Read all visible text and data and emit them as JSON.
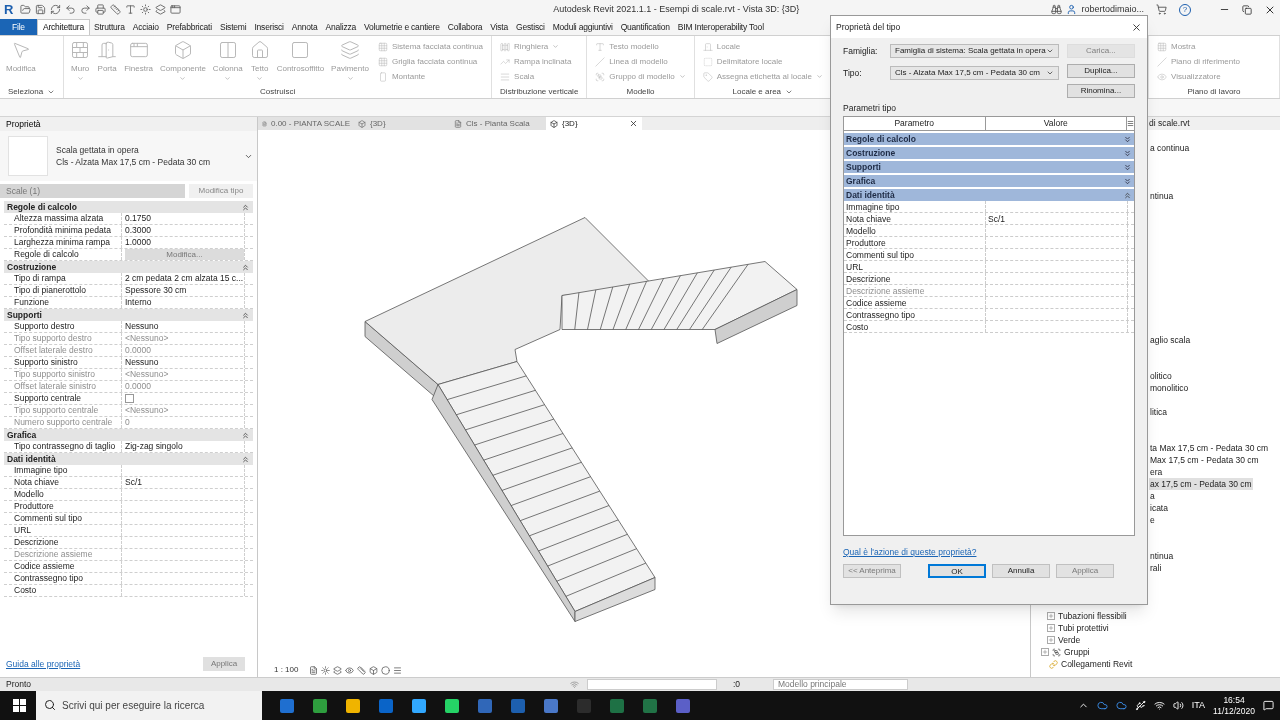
{
  "title_bar": {
    "logo": "R",
    "title": "Autodesk Revit 2021.1.1 - Esempi di scale.rvt - Vista 3D: {3D}",
    "user": "robertodimaio...",
    "help": "?"
  },
  "ribbon_tabs": [
    {
      "label": "File",
      "kind": "file",
      "selected": false
    },
    {
      "label": "Architettura",
      "kind": "tab",
      "selected": true
    },
    {
      "label": "Struttura",
      "kind": "tab",
      "selected": false
    },
    {
      "label": "Acciaio",
      "kind": "tab",
      "selected": false
    },
    {
      "label": "Prefabbricati",
      "kind": "tab",
      "selected": false
    },
    {
      "label": "Sistemi",
      "kind": "tab",
      "selected": false
    },
    {
      "label": "Inserisci",
      "kind": "tab",
      "selected": false
    },
    {
      "label": "Annota",
      "kind": "tab",
      "selected": false
    },
    {
      "label": "Analizza",
      "kind": "tab",
      "selected": false
    },
    {
      "label": "Volumetrie e cantiere",
      "kind": "tab",
      "selected": false
    },
    {
      "label": "Collabora",
      "kind": "tab",
      "selected": false
    },
    {
      "label": "Vista",
      "kind": "tab",
      "selected": false
    },
    {
      "label": "Gestisci",
      "kind": "tab",
      "selected": false
    },
    {
      "label": "Moduli aggiuntivi",
      "kind": "tab",
      "selected": false
    },
    {
      "label": "Quantification",
      "kind": "tab",
      "selected": false
    },
    {
      "label": "BIM Interoperability Tool",
      "kind": "tab",
      "selected": false
    }
  ],
  "ribbon_panels": [
    {
      "label": "Seleziona",
      "menu": true,
      "large": [
        {
          "label": "Modifica",
          "menu": false
        }
      ]
    },
    {
      "label": "Costruisci",
      "menu": false,
      "large": [
        {
          "label": "Muro",
          "menu": true
        },
        {
          "label": "Porta",
          "menu": false
        },
        {
          "label": "Finestra",
          "menu": false
        },
        {
          "label": "Componente",
          "menu": true
        },
        {
          "label": "Colonna",
          "menu": true
        },
        {
          "label": "Tetto",
          "menu": true
        },
        {
          "label": "Controsoffitto",
          "menu": false
        },
        {
          "label": "Pavimento",
          "menu": true
        }
      ],
      "small": [
        {
          "label": "Sistema facciata continua",
          "menu": false
        },
        {
          "label": "Griglia facciata continua",
          "menu": false
        },
        {
          "label": "Montante",
          "menu": false
        }
      ]
    },
    {
      "label": "Distribuzione verticale",
      "menu": false,
      "small": [
        {
          "label": "Ringhiera",
          "menu": true
        },
        {
          "label": "Rampa inclinata",
          "menu": false
        },
        {
          "label": "Scala",
          "menu": false
        }
      ]
    },
    {
      "label": "Modello",
      "menu": false,
      "small": [
        {
          "label": "Testo modello",
          "menu": false
        },
        {
          "label": "Linea di modello",
          "menu": false
        },
        {
          "label": "Gruppo di modello",
          "menu": true
        }
      ]
    },
    {
      "label": "Locale e area",
      "menu": true,
      "small": [
        {
          "label": "Locale",
          "menu": false
        },
        {
          "label": "Delimitatore locale",
          "menu": false
        },
        {
          "label": "Assegna etichetta al locale",
          "menu": true
        }
      ]
    },
    {
      "label": "Piano di lavoro",
      "menu": false,
      "small": [
        {
          "label": "Mostra",
          "menu": false
        },
        {
          "label": "Piano di riferimento",
          "menu": false
        },
        {
          "label": "Visualizzatore",
          "menu": false
        }
      ]
    }
  ],
  "properties": {
    "title": "Proprietà",
    "type_family": "Scala gettata in opera",
    "type_name": "Cls - Alzata Max 17,5 cm - Pedata 30 cm",
    "filter": "Scale (1)",
    "edit_type": "Modifica tipo",
    "groups": [
      {
        "name": "Regole di calcolo",
        "expanded": true,
        "rows": [
          {
            "label": "Altezza massima alzata",
            "value": "0.1750",
            "kind": "text",
            "dim": false
          },
          {
            "label": "Profondità minima pedata",
            "value": "0.3000",
            "kind": "text",
            "dim": false
          },
          {
            "label": "Larghezza minima rampa",
            "value": "1.0000",
            "kind": "text",
            "dim": false
          },
          {
            "label": "Regole di calcolo",
            "value": "Modifica...",
            "kind": "button",
            "dim": false
          }
        ]
      },
      {
        "name": "Costruzione",
        "expanded": true,
        "rows": [
          {
            "label": "Tipo di rampa",
            "value": "2 cm pedata 2 cm alzata 15 c...",
            "kind": "text",
            "dim": false
          },
          {
            "label": "Tipo di pianerottolo",
            "value": "Spessore 30 cm",
            "kind": "text",
            "dim": false
          },
          {
            "label": "Funzione",
            "value": "Interno",
            "kind": "text",
            "dim": false
          }
        ]
      },
      {
        "name": "Supporti",
        "expanded": true,
        "rows": [
          {
            "label": "Supporto destro",
            "value": "Nessuno",
            "kind": "text",
            "dim": false
          },
          {
            "label": "Tipo supporto destro",
            "value": "<Nessuno>",
            "kind": "text",
            "dim": true
          },
          {
            "label": "Offset laterale destro",
            "value": "0.0000",
            "kind": "text",
            "dim": true
          },
          {
            "label": "Supporto sinistro",
            "value": "Nessuno",
            "kind": "text",
            "dim": false
          },
          {
            "label": "Tipo supporto sinistro",
            "value": "<Nessuno>",
            "kind": "text",
            "dim": true
          },
          {
            "label": "Offset laterale sinistro",
            "value": "0.0000",
            "kind": "text",
            "dim": true
          },
          {
            "label": "Supporto centrale",
            "kind": "checkbox",
            "checked": false,
            "dim": false
          },
          {
            "label": "Tipo supporto centrale",
            "value": "<Nessuno>",
            "kind": "text",
            "dim": true
          },
          {
            "label": "Numero supporto centrale",
            "value": "0",
            "kind": "text",
            "dim": true
          }
        ]
      },
      {
        "name": "Grafica",
        "expanded": true,
        "rows": [
          {
            "label": "Tipo contrassegno di taglio",
            "value": "Zig-zag singolo",
            "kind": "text",
            "dim": false
          }
        ]
      },
      {
        "name": "Dati identità",
        "expanded": true,
        "rows": [
          {
            "label": "Immagine tipo",
            "kind": "text",
            "dim": false
          },
          {
            "label": "Nota chiave",
            "value": "Sc/1",
            "kind": "text",
            "dim": false
          },
          {
            "label": "Modello",
            "kind": "text",
            "dim": false
          },
          {
            "label": "Produttore",
            "kind": "text",
            "dim": false
          },
          {
            "label": "Commenti sul tipo",
            "kind": "text",
            "dim": false
          },
          {
            "label": "URL",
            "kind": "text",
            "dim": false
          },
          {
            "label": "Descrizione",
            "kind": "text",
            "dim": false
          },
          {
            "label": "Descrizione assieme",
            "kind": "text",
            "dim": true
          },
          {
            "label": "Codice assieme",
            "kind": "text",
            "dim": false
          },
          {
            "label": "Contrassegno tipo",
            "kind": "text",
            "dim": false
          },
          {
            "label": "Costo",
            "kind": "text",
            "dim": false
          }
        ]
      }
    ],
    "help_link": "Guida alle proprietà",
    "apply": "Applica"
  },
  "view_tabs": [
    {
      "label": "0.00 - PIANTA SCALE",
      "kind": "plan",
      "selected": false
    },
    {
      "label": "{3D}",
      "kind": "model",
      "selected": false
    },
    {
      "label": "Cls - Pianta Scala",
      "kind": "plan",
      "selected": false
    },
    {
      "label": "{3D}",
      "kind": "model",
      "selected": true
    }
  ],
  "view_bar": {
    "scale": "1 : 100"
  },
  "browser": {
    "title": "di scale.rvt",
    "partial_rows": [
      {
        "text": "a continua",
        "selected": false
      },
      {
        "text": "ntinua",
        "selected": false
      },
      {
        "text": "aglio scala",
        "selected": false
      },
      {
        "text": "olitico",
        "selected": false
      },
      {
        "text": "monolitico",
        "selected": false
      },
      {
        "text": "litica",
        "selected": false
      },
      {
        "text": "ta Max 17,5 cm - Pedata 30 cm",
        "selected": false
      },
      {
        "text": "Max 17,5 cm - Pedata 30 cm",
        "selected": false
      },
      {
        "text": "era",
        "selected": false
      },
      {
        "text": "ax 17,5 cm - Pedata 30 cm",
        "selected": true
      },
      {
        "text": "a",
        "selected": false
      },
      {
        "text": "icata",
        "selected": false
      },
      {
        "text": "e",
        "selected": false
      },
      {
        "text": "ntinua",
        "selected": false
      },
      {
        "text": "rali",
        "selected": false
      }
    ],
    "tree": [
      {
        "label": "Tubazioni flessibili",
        "kind": "branch"
      },
      {
        "label": "Tubi protettivi",
        "kind": "branch"
      },
      {
        "label": "Verde",
        "kind": "branch"
      },
      {
        "label": "Gruppi",
        "kind": "group"
      },
      {
        "label": "Collegamenti Revit",
        "kind": "link"
      }
    ]
  },
  "dialog": {
    "title": "Proprietà del tipo",
    "family_label": "Famiglia:",
    "family": "Famiglia di sistema: Scala gettata in opera",
    "type_label": "Tipo:",
    "type": "Cls - Alzata Max 17,5 cm - Pedata 30 cm",
    "side_buttons": [
      {
        "label": "Carica...",
        "disabled": true
      },
      {
        "label": "Duplica...",
        "disabled": false
      },
      {
        "label": "Rinomina...",
        "disabled": false
      }
    ],
    "params_label": "Parametri tipo",
    "columns": [
      "Parametro",
      "Valore"
    ],
    "groups": [
      {
        "name": "Regole di calcolo",
        "expanded": false
      },
      {
        "name": "Costruzione",
        "expanded": false
      },
      {
        "name": "Supporti",
        "expanded": false
      },
      {
        "name": "Grafica",
        "expanded": false
      },
      {
        "name": "Dati identità",
        "expanded": true,
        "rows": [
          {
            "label": "Immagine tipo",
            "dim": false
          },
          {
            "label": "Nota chiave",
            "value": "Sc/1",
            "dim": false
          },
          {
            "label": "Modello",
            "dim": false
          },
          {
            "label": "Produttore",
            "dim": false
          },
          {
            "label": "Commenti sul tipo",
            "dim": false
          },
          {
            "label": "URL",
            "dim": false
          },
          {
            "label": "Descrizione",
            "dim": false
          },
          {
            "label": "Descrizione assieme",
            "dim": true
          },
          {
            "label": "Codice assieme",
            "dim": false
          },
          {
            "label": "Contrassegno tipo",
            "dim": false
          },
          {
            "label": "Costo",
            "dim": false
          }
        ]
      }
    ],
    "help_link": "Qual è l'azione di queste proprietà?",
    "buttons": [
      {
        "label": "<< Anteprima",
        "disabled": true,
        "default": false
      },
      {
        "label": "OK",
        "disabled": false,
        "default": true
      },
      {
        "label": "Annulla",
        "disabled": false,
        "default": false
      },
      {
        "label": "Applica",
        "disabled": true,
        "default": false
      }
    ]
  },
  "status_bar": {
    "text": "Pronto",
    "selection": ":0",
    "model": "Modello principale"
  },
  "taskbar": {
    "search_placeholder": "Scrivi qui per eseguire la ricerca",
    "language": "ITA",
    "time": "16:54",
    "date": "11/12/2020"
  }
}
